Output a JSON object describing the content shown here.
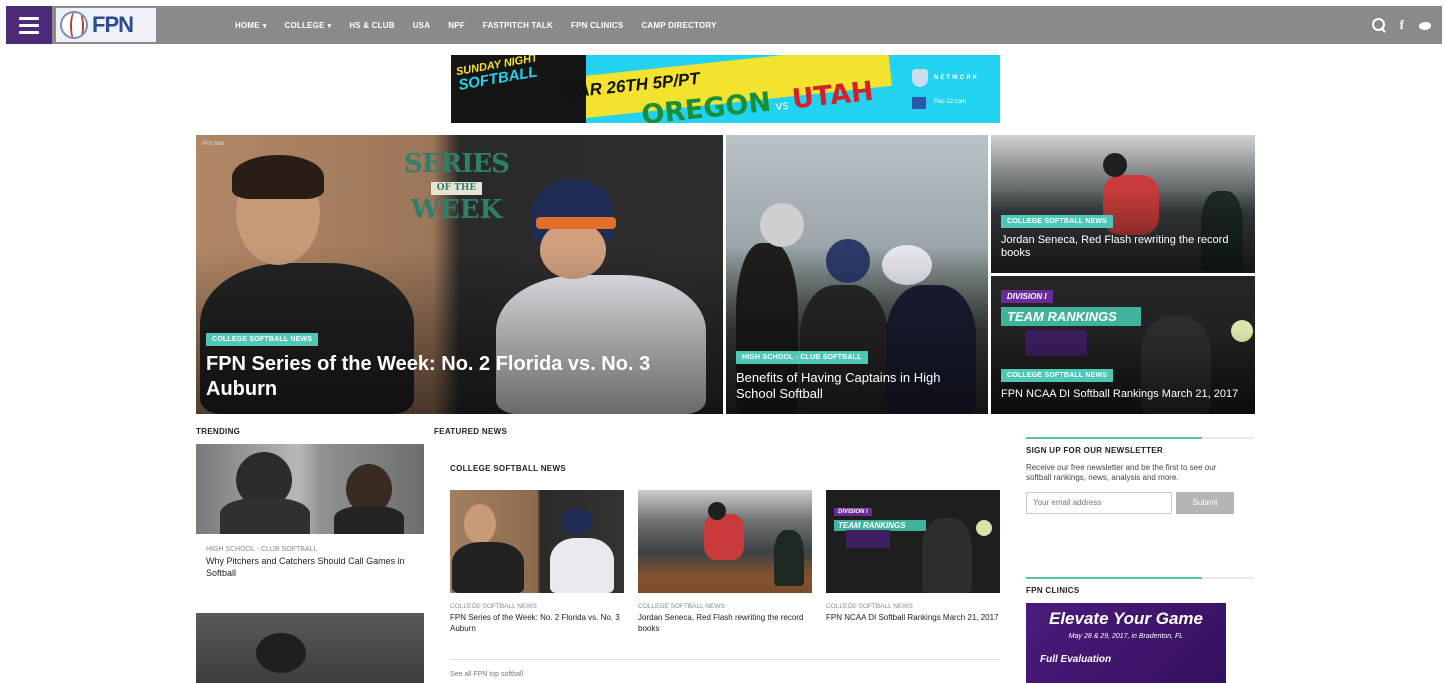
{
  "nav": {
    "logo_text": "FPN",
    "items": [
      {
        "label": "HOME",
        "has_caret": true
      },
      {
        "label": "COLLEGE",
        "has_caret": true
      },
      {
        "label": "HS & CLUB",
        "has_caret": false
      },
      {
        "label": "USA",
        "has_caret": false
      },
      {
        "label": "NPF",
        "has_caret": false
      },
      {
        "label": "FASTPITCH TALK",
        "has_caret": false
      },
      {
        "label": "FPN CLINICS",
        "has_caret": false
      },
      {
        "label": "CAMP DIRECTORY",
        "has_caret": false
      }
    ],
    "caret": "▾",
    "icons": [
      "search-icon",
      "facebook-icon",
      "twitter-icon"
    ],
    "facebook_glyph": "f"
  },
  "ad": {
    "kicker_small": "SUNDAY NIGHT",
    "kicker_big": "SOFTBALL",
    "date": "MAR 26TH 5P/PT",
    "team1": "OREGON",
    "vs": "vs",
    "team2": "UTAH",
    "network": "NETWORK",
    "network_sub": "Pac-12.com"
  },
  "hero": {
    "main": {
      "credit": "FPN Staff",
      "sotw_l1": "SERIES",
      "sotw_l2": "OF THE",
      "sotw_l3": "WEEK",
      "tag": "COLLEGE SOFTBALL NEWS",
      "title": "FPN Series of the Week: No. 2 Florida vs. No. 3 Auburn"
    },
    "mid": {
      "tag": "HIGH SCHOOL - CLUB SOFTBALL",
      "title": "Benefits of Having Captains in High School Softball"
    },
    "right1": {
      "tag": "COLLEGE SOFTBALL NEWS",
      "title": "Jordan Seneca, Red Flash rewriting the record books"
    },
    "right2": {
      "badge_l1": "DIVISION I",
      "badge_l2": "TEAM RANKINGS",
      "tag": "COLLEGE SOFTBALL NEWS",
      "title": "FPN NCAA DI Softball Rankings March 21, 2017"
    }
  },
  "trending": {
    "heading": "TRENDING",
    "item1": {
      "category": "HIGH SCHOOL - CLUB SOFTBALL",
      "title": "Why Pitchers and Catchers Should Call Games in Softball"
    }
  },
  "featured": {
    "heading": "FEATURED NEWS",
    "subheading": "COLLEGE SOFTBALL NEWS",
    "cards": [
      {
        "category": "COLLEGE SOFTBALL NEWS",
        "title": "FPN Series of the Week: No. 2 Florida vs. No. 3 Auburn"
      },
      {
        "category": "COLLEGE SOFTBALL NEWS",
        "title": "Jordan Seneca, Red Flash rewriting the record books"
      },
      {
        "category": "COLLEGE SOFTBALL NEWS",
        "title": "FPN NCAA DI Softball Rankings March 21, 2017"
      }
    ],
    "card3_badge_l1": "DIVISION I",
    "card3_badge_l2": "TEAM RANKINGS",
    "more": "See all FPN top softball"
  },
  "sidebar": {
    "newsletter_heading": "SIGN UP FOR OUR NEWSLETTER",
    "newsletter_text": "Receive our free newsletter and be the first to see our softball rankings, news, analysis and more.",
    "email_placeholder": "Your email address",
    "submit_label": "Submit",
    "clinics_heading": "FPN CLINICS",
    "clinic_title": "Elevate Your Game",
    "clinic_dates": "May 28 & 29, 2017, in Bradenton, FL",
    "clinic_sub": "Full Evaluation"
  },
  "colors": {
    "nav_bg": "#8a8a8a",
    "brand_purple": "#4b2a7a",
    "tag_teal": "#4ec7b7",
    "ad_cyan": "#21d3f0",
    "ad_yellow": "#f3e32e"
  }
}
